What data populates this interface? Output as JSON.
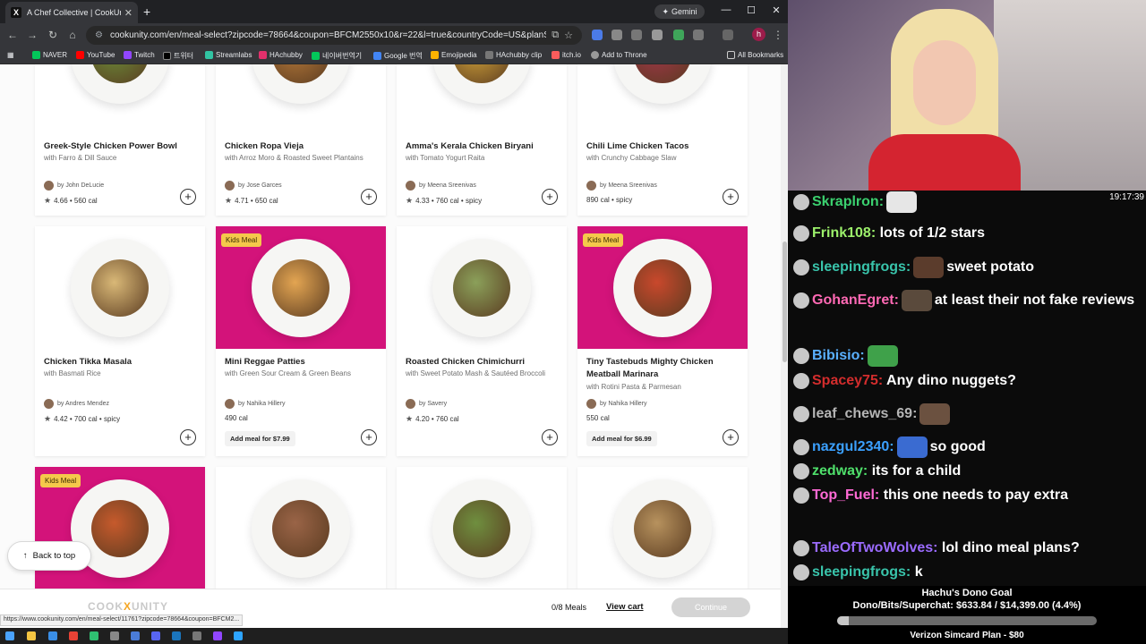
{
  "browser": {
    "tab_title": "A Chef Collective | CookUnity |",
    "tab_close": "✕",
    "new_tab": "+",
    "gemini_label": "Gemini",
    "url": "cookunity.com/en/meal-select?zipcode=78664&coupon=BFCM2550x10&r=22&l=true&countryCode=US&planSize=8&m...",
    "profile_initial": "h",
    "bookmarks": [
      "NAVER",
      "YouTube",
      "Twitch",
      "트위터",
      "Streamlabs",
      "HAchubby",
      "네이버번역기",
      "Google 번역",
      "Emojipedia",
      "HAchubby clip",
      "itch.io",
      "Add to Throne"
    ],
    "all_bookmarks": "All Bookmarks",
    "status_url": "https://www.cookunity.com/en/meal-select/11761?zipcode=78664&coupon=BFCM2..."
  },
  "cards": [
    {
      "title": "Greek-Style Chicken Power Bowl",
      "sub": "with Farro & Dill Sauce",
      "chef": "by John DeLucie",
      "stats": "4.66 • 560 cal",
      "rated": true,
      "kids": "",
      "add": "",
      "img": "white",
      "food": "#6b8f3a"
    },
    {
      "title": "Chicken Ropa Vieja",
      "sub": "with Arroz Moro & Roasted Sweet Plantains",
      "chef": "by Jose Garces",
      "stats": "4.71 • 650 cal",
      "rated": true,
      "kids": "",
      "add": "",
      "img": "white",
      "food": "#b77a3a"
    },
    {
      "title": "Amma's Kerala Chicken Biryani",
      "sub": "with Tomato Yogurt Raita",
      "chef": "by Meena Sreenivas",
      "stats": "4.33 • 760 cal • spicy",
      "rated": true,
      "kids": "",
      "add": "",
      "img": "white",
      "food": "#d4a53a"
    },
    {
      "title": "Chili Lime Chicken Tacos",
      "sub": "with Crunchy Cabbage Slaw",
      "chef": "by Meena Sreenivas",
      "stats": "890 cal • spicy",
      "rated": false,
      "kids": "",
      "add": "",
      "img": "white",
      "food": "#a3354a"
    },
    {
      "title": "Chicken Tikka Masala",
      "sub": "with Basmati Rice",
      "chef": "by Andres Mendez",
      "stats": "4.42 • 700 cal • spicy",
      "rated": true,
      "kids": "",
      "add": "",
      "img": "white",
      "food": "#d9b877"
    },
    {
      "title": "Mini Reggae Patties",
      "sub": "with Green Sour Cream & Green Beans",
      "chef": "by Nahika Hillery",
      "stats": "490 cal",
      "rated": false,
      "kids": "Kids Meal",
      "add": "Add meal for $7.99",
      "img": "pink",
      "food": "#e3a552"
    },
    {
      "title": "Roasted Chicken Chimichurri",
      "sub": "with Sweet Potato Mash & Sautéed Broccoli",
      "chef": "by Savery",
      "stats": "4.20 • 760 cal",
      "rated": true,
      "kids": "",
      "add": "",
      "img": "white",
      "food": "#8ba05a"
    },
    {
      "title": "Tiny Tastebuds Mighty Chicken Meatball Marinara",
      "sub": "with Rotini Pasta & Parmesan",
      "chef": "by Nahika Hillery",
      "stats": "550 cal",
      "rated": false,
      "kids": "Kids Meal",
      "add": "Add meal for $6.99",
      "img": "pink",
      "food": "#c9482c"
    },
    {
      "title": "",
      "sub": "",
      "chef": "",
      "stats": "",
      "rated": false,
      "kids": "Kids Meal",
      "add": "",
      "img": "pink",
      "food": "#c65a2c"
    },
    {
      "title": "",
      "sub": "",
      "chef": "",
      "stats": "",
      "rated": false,
      "kids": "",
      "add": "",
      "img": "white",
      "food": "#9a6447"
    },
    {
      "title": "",
      "sub": "",
      "chef": "",
      "stats": "",
      "rated": false,
      "kids": "",
      "add": "",
      "img": "white",
      "food": "#6f8f3f"
    },
    {
      "title": "",
      "sub": "",
      "chef": "",
      "stats": "",
      "rated": false,
      "kids": "",
      "add": "",
      "img": "white",
      "food": "#b7925e"
    }
  ],
  "page": {
    "back_to_top": "Back to top",
    "logo_a": "COOK",
    "logo_x": "X",
    "logo_b": "UNITY",
    "meals_count": "0/8 Meals",
    "view_cart": "View cart",
    "continue": "Continue"
  },
  "chat": {
    "clock": "19:17:39",
    "messages": [
      {
        "user": "Skraplron",
        "color": "#3bd16f",
        "text": "",
        "emote_after_user": true
      },
      {
        "user": "Frink108",
        "color": "#9cf06b",
        "text": "lots of 1/2 stars",
        "emote_after_user": false
      },
      {
        "user": "sleepingfrogs",
        "color": "#39c4ab",
        "text": "sweet potato",
        "emote_after_user": true
      },
      {
        "user": "GohanEgret",
        "color": "#ff69b4",
        "text": "at least their not fake reviews",
        "emote_after_user": true
      },
      {
        "user": "Bibisio",
        "color": "#5ab0ff",
        "text": "",
        "emote_after_user": true
      },
      {
        "user": "Spacey75",
        "color": "#d42d2d",
        "text": "Any dino nuggets?",
        "emote_after_user": false
      },
      {
        "user": "leaf_chews_69",
        "color": "#b5b5b5",
        "text": "",
        "emote_after_user": true
      },
      {
        "user": "nazgul2340",
        "color": "#3ba0ff",
        "text": "so good",
        "emote_after_user": true
      },
      {
        "user": "zedway",
        "color": "#4fe06b",
        "text": "its for a child",
        "emote_after_user": false
      },
      {
        "user": "Top_Fuel",
        "color": "#ff6ad5",
        "text": "this one needs to pay extra",
        "emote_after_user": false
      },
      {
        "user": "TaleOfTwoWolves",
        "color": "#9b6bff",
        "text": "lol dino meal plans?",
        "emote_after_user": false
      },
      {
        "user": "sleepingfrogs",
        "color": "#39c4ab",
        "text": "k",
        "emote_after_user": false
      }
    ]
  },
  "dono": {
    "title": "Hachu's Dono Goal",
    "amount": "Dono/Bits/Superchat: $633.84 / $14,399.00 (4.4%)",
    "progress": 0.044,
    "next": "Verizon Simcard Plan - $80"
  }
}
